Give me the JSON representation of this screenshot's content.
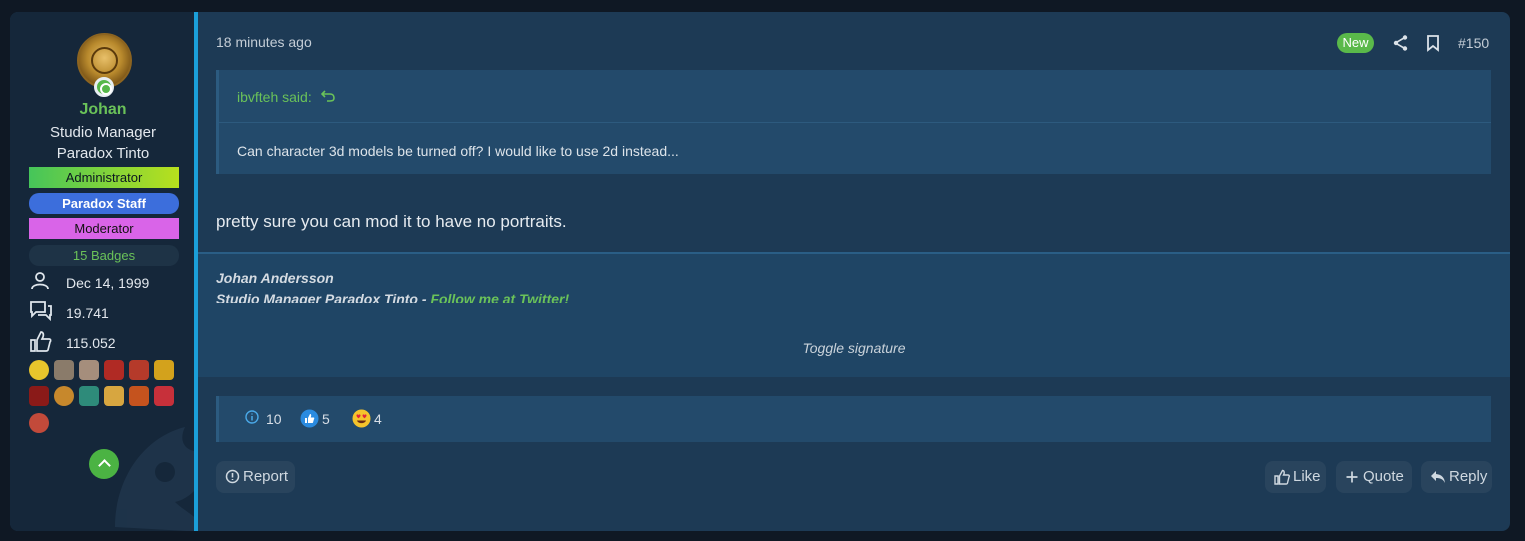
{
  "user": {
    "name": "Johan",
    "title": "Studio Manager",
    "company": "Paradox Tinto",
    "banners": {
      "admin": "Administrator",
      "staff": "Paradox Staff",
      "moderator": "Moderator",
      "badges": "15 Badges"
    },
    "stats": {
      "joined": "Dec 14, 1999",
      "messages": "19.741",
      "reactions": "115.052"
    },
    "trophy_count": 13
  },
  "post": {
    "time": "18 minutes ago",
    "new_label": "New",
    "number": "#150",
    "quote": {
      "author": "ibvfteh said:",
      "text": "Can character 3d models be turned off? I would like to use 2d instead..."
    },
    "message": "pretty sure you can mod it to have no portraits.",
    "signature": {
      "name": "Johan Andersson",
      "line": "Studio Manager Paradox Tinto - ",
      "link": "Follow me at Twitter!"
    },
    "toggle_signature": "Toggle signature",
    "reactions": [
      {
        "icon": "info-icon",
        "count": "10"
      },
      {
        "icon": "like-icon",
        "count": "5"
      },
      {
        "icon": "love-eyes-icon",
        "count": "4"
      }
    ],
    "actions": {
      "report": "Report",
      "like": "Like",
      "quote": "Quote",
      "reply": "Reply"
    }
  },
  "colors": {
    "accent": "#1b9fd9",
    "green": "#6ac259",
    "post_bg": "#1d3a55",
    "sidebar_bg": "#15273a"
  }
}
